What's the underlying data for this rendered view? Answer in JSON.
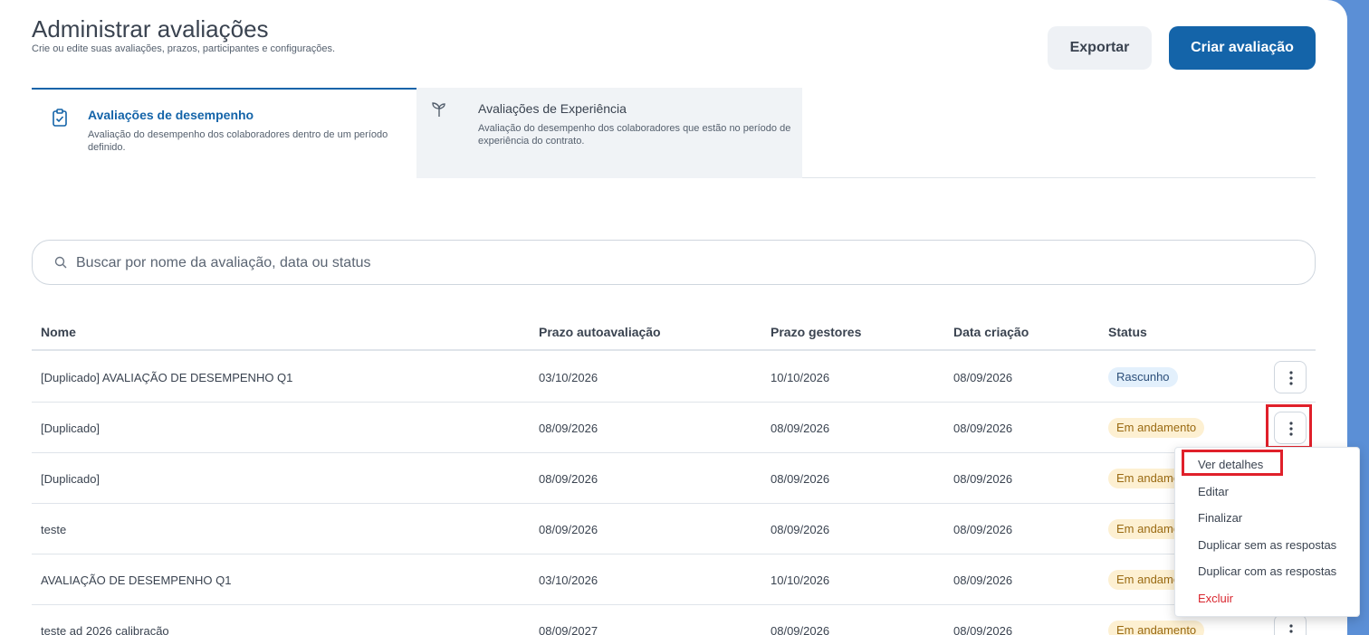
{
  "header": {
    "title": "Administrar avaliações",
    "subtitle": "Crie ou edite suas avaliações, prazos, participantes e configurações.",
    "export_label": "Exportar",
    "create_label": "Criar avaliação"
  },
  "tabs": [
    {
      "title": "Avaliações de desempenho",
      "description": "Avaliação do desempenho dos colaboradores dentro de um período definido.",
      "icon": "clipboard-check-icon",
      "active": true
    },
    {
      "title": "Avaliações de Experiência",
      "description": "Avaliação do desempenho dos colaboradores que estão no período de experiência do contrato.",
      "icon": "sprout-icon",
      "active": false
    }
  ],
  "search": {
    "placeholder": "Buscar por nome da avaliação, data ou status",
    "value": ""
  },
  "table": {
    "columns": [
      "Nome",
      "Prazo autoavaliação",
      "Prazo gestores",
      "Data criação",
      "Status"
    ],
    "rows": [
      {
        "name": "[Duplicado] AVALIAÇÃO DE DESEMPENHO Q1",
        "self_deadline": "03/10/2026",
        "manager_deadline": "10/10/2026",
        "created": "08/09/2026",
        "status": "Rascunho"
      },
      {
        "name": "[Duplicado]",
        "self_deadline": "08/09/2026",
        "manager_deadline": "08/09/2026",
        "created": "08/09/2026",
        "status": "Em andamento"
      },
      {
        "name": "[Duplicado]",
        "self_deadline": "08/09/2026",
        "manager_deadline": "08/09/2026",
        "created": "08/09/2026",
        "status": "Em andamento"
      },
      {
        "name": "teste",
        "self_deadline": "08/09/2026",
        "manager_deadline": "08/09/2026",
        "created": "08/09/2026",
        "status": "Em andamento"
      },
      {
        "name": "AVALIAÇÃO DE DESEMPENHO Q1",
        "self_deadline": "03/10/2026",
        "manager_deadline": "10/10/2026",
        "created": "08/09/2026",
        "status": "Em andamento"
      },
      {
        "name": "teste ad 2026 calibração",
        "self_deadline": "08/09/2027",
        "manager_deadline": "08/09/2026",
        "created": "08/09/2026",
        "status": "Em andamento"
      }
    ]
  },
  "context_menu": {
    "items": [
      "Ver detalhes",
      "Editar",
      "Finalizar",
      "Duplicar sem as respostas",
      "Duplicar com as respostas",
      "Excluir"
    ]
  },
  "colors": {
    "primary": "#1464a9",
    "danger": "#d9262e",
    "highlight": "#e0202a",
    "draft_bg": "#e3f0fc",
    "progress_bg": "#fdf0d2"
  }
}
